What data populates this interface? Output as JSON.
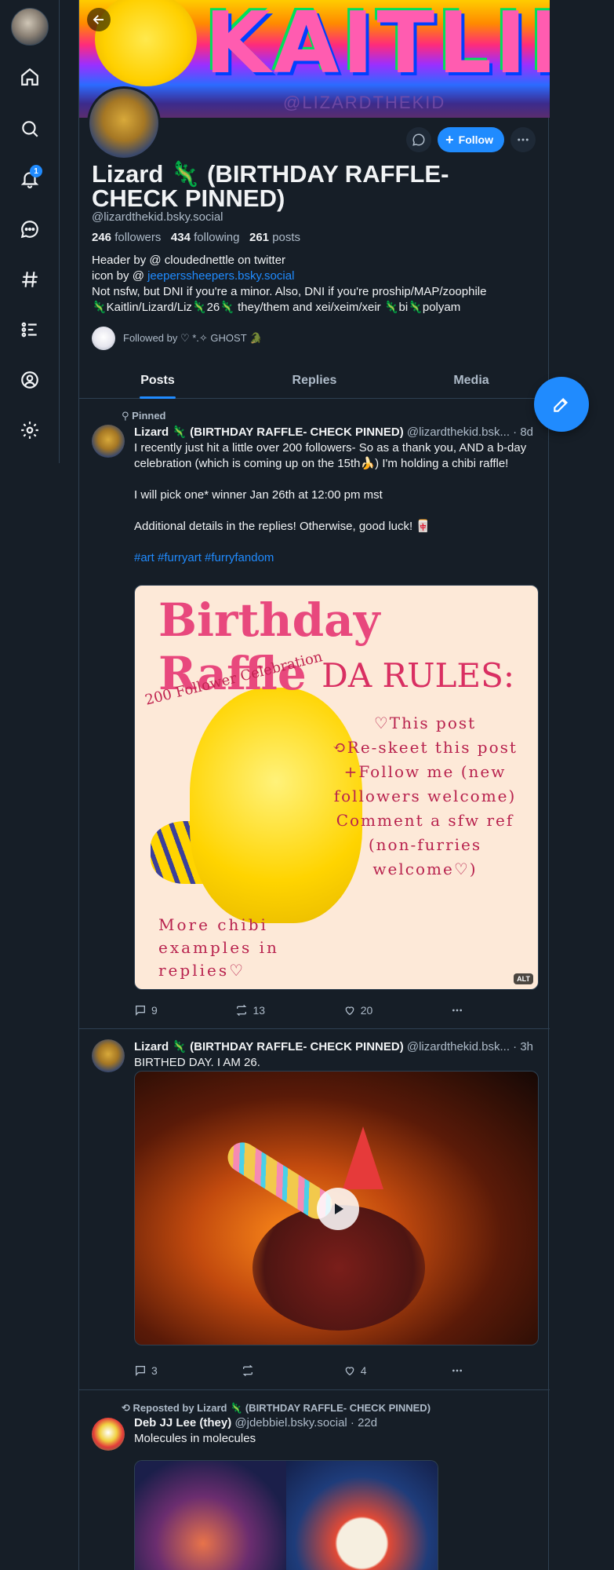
{
  "nav": {
    "notifications_count": "1",
    "items": [
      "home",
      "search",
      "notifications",
      "chat",
      "feeds",
      "lists",
      "profile",
      "settings"
    ]
  },
  "banner": {
    "text": "KAITLIN",
    "sub": "@LIZARDTHEKID"
  },
  "profile": {
    "display_name": "Lizard 🦎 (BIRTHDAY RAFFLE- CHECK PINNED)",
    "handle": "@lizardthekid.bsky.social",
    "followers_count": "246",
    "followers_label": "followers",
    "following_count": "434",
    "following_label": "following",
    "posts_count": "261",
    "posts_label": "posts",
    "follow_label": "Follow",
    "bio_line1": "Header by @ cloudednettle on twitter",
    "bio_line2_prefix": "icon by @ ",
    "bio_line2_link": "jeeperssheepers.bsky.social",
    "bio_line3": "Not nsfw, but DNI if you're a minor. Also, DNI if you're proship/MAP/zoophile",
    "bio_line4": "🦎Kaitlin/Lizard/Liz🦎26🦎 they/them and xei/xeim/xeir 🦎bi🦎polyam",
    "followed_by": "Followed by ♡ *.✧ GHOST 🐊"
  },
  "tabs": [
    {
      "label": "Posts"
    },
    {
      "label": "Replies"
    },
    {
      "label": "Media"
    }
  ],
  "posts": [
    {
      "label": "Pinned",
      "name": "Lizard 🦎 (BIRTHDAY RAFFLE- CHECK PINNED)",
      "handle": "@lizardthekid.bsk...",
      "time": "· 8d",
      "text1": "I recently just hit a little over 200 followers- So as a thank you, AND a b-day celebration (which is coming up on the 15th🍌) I'm holding a chibi raffle!",
      "text2": "I will pick one* winner Jan 26th at 12:00 pm mst",
      "text3": "Additional details in the replies! Otherwise, good luck! 🀄",
      "tags": "#art #furryart #furryfandom",
      "image": {
        "title": "Birthday Raffle",
        "rules": "DA RULES:",
        "celebration": "200 Follower Celebration",
        "rule1": "♡This post",
        "rule2": "⟲Re-skeet this post",
        "rule3": "+Follow me (new followers welcome)",
        "rule4": "Comment a sfw ref (non-furries welcome♡)",
        "more": "More chibi examples in replies♡",
        "alt": "ALT"
      },
      "replies": "9",
      "reposts": "13",
      "likes": "20"
    },
    {
      "name": "Lizard 🦎 (BIRTHDAY RAFFLE- CHECK PINNED)",
      "handle": "@lizardthekid.bsk...",
      "time": "· 3h",
      "text": "BIRTHED DAY. I AM 26.",
      "replies": "3",
      "reposts": "",
      "likes": "4"
    },
    {
      "label": "Reposted by Lizard 🦎 (BIRTHDAY RAFFLE- CHECK PINNED)",
      "name": "Deb JJ Lee (they)",
      "handle": "@jdebbiel.bsky.social",
      "time": "· 22d",
      "text": "Molecules in molecules"
    }
  ],
  "colors": {
    "background": "#161e27",
    "accent": "#208bfe",
    "border": "#2e4052",
    "muted_text": "#aebbc9"
  }
}
